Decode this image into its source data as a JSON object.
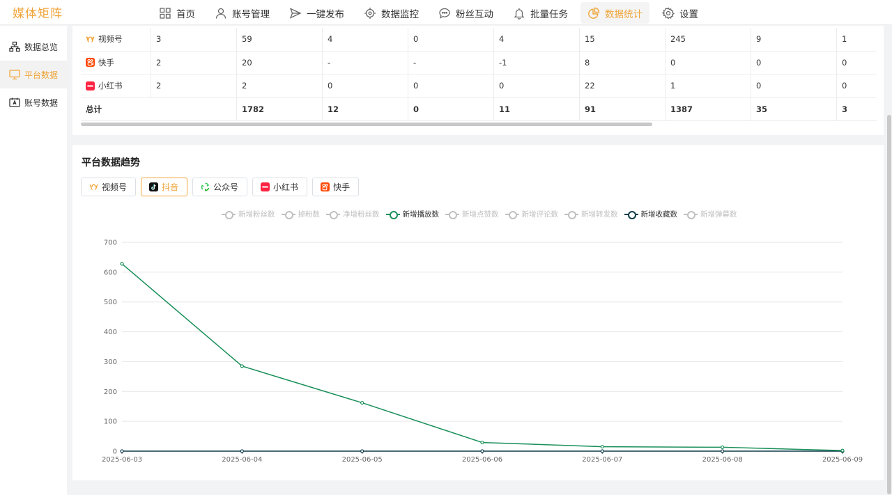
{
  "app": {
    "title": "媒体矩阵"
  },
  "nav": {
    "items": [
      {
        "label": "首页",
        "icon": "grid-icon"
      },
      {
        "label": "账号管理",
        "icon": "user-icon"
      },
      {
        "label": "一键发布",
        "icon": "send-icon"
      },
      {
        "label": "数据监控",
        "icon": "crosshair-icon"
      },
      {
        "label": "粉丝互动",
        "icon": "chat-icon"
      },
      {
        "label": "批量任务",
        "icon": "bell-icon"
      },
      {
        "label": "数据统计",
        "icon": "pie-chart-icon",
        "active": true
      },
      {
        "label": "设置",
        "icon": "gear-icon"
      }
    ]
  },
  "sidebar": {
    "items": [
      {
        "label": "数据总览",
        "icon": "hierarchy-icon"
      },
      {
        "label": "平台数据",
        "icon": "monitor-icon",
        "active": true
      },
      {
        "label": "账号数据",
        "icon": "id-card-icon"
      }
    ]
  },
  "table": {
    "rows": [
      {
        "platform": "视频号",
        "icon": "wechat-channels-icon",
        "cells": [
          "3",
          "59",
          "4",
          "0",
          "4",
          "15",
          "245",
          "9",
          "1"
        ]
      },
      {
        "platform": "快手",
        "icon": "kuaishou-icon",
        "cells": [
          "2",
          "20",
          "-",
          "-",
          "-1",
          "8",
          "0",
          "0",
          "0"
        ]
      },
      {
        "platform": "小红书",
        "icon": "xiaohongshu-icon",
        "cells": [
          "2",
          "2",
          "0",
          "0",
          "0",
          "22",
          "1",
          "0",
          "0"
        ]
      }
    ],
    "total": {
      "label": "总计",
      "cells": [
        "1782",
        "12",
        "0",
        "11",
        "91",
        "1387",
        "35",
        "3"
      ]
    }
  },
  "trend": {
    "title": "平台数据趋势",
    "platform_tabs": [
      {
        "label": "视频号",
        "icon": "wechat-channels-icon"
      },
      {
        "label": "抖音",
        "icon": "douyin-icon",
        "active": true
      },
      {
        "label": "公众号",
        "icon": "wechat-official-icon"
      },
      {
        "label": "小红书",
        "icon": "xiaohongshu-icon"
      },
      {
        "label": "快手",
        "icon": "kuaishou-icon"
      }
    ]
  },
  "colors": {
    "accent": "#f0a53b",
    "plays_line": "#1a8f5a",
    "favorites_line": "#0e3a4a",
    "legend_off": "#c0c0c0"
  },
  "chart_data": {
    "type": "line",
    "x": [
      "2025-06-03",
      "2025-06-04",
      "2025-06-05",
      "2025-06-06",
      "2025-06-07",
      "2025-06-08",
      "2025-06-09"
    ],
    "ylim": [
      0,
      700
    ],
    "yticks": [
      0,
      100,
      200,
      300,
      400,
      500,
      600,
      700
    ],
    "grid": true,
    "legend_position": "top-center",
    "legend": [
      {
        "name": "新增粉丝数",
        "visible": false
      },
      {
        "name": "掉粉数",
        "visible": false
      },
      {
        "name": "净增粉丝数",
        "visible": false
      },
      {
        "name": "新增播放数",
        "visible": true
      },
      {
        "name": "新增点赞数",
        "visible": false
      },
      {
        "name": "新增评论数",
        "visible": false
      },
      {
        "name": "新增转发数",
        "visible": false
      },
      {
        "name": "新增收藏数",
        "visible": true
      },
      {
        "name": "新增弹幕数",
        "visible": false
      }
    ],
    "series": [
      {
        "name": "新增播放数",
        "values": [
          628,
          285,
          162,
          29,
          15,
          13,
          2
        ]
      },
      {
        "name": "新增收藏数",
        "values": [
          0,
          0,
          0,
          0,
          0,
          0,
          0
        ]
      }
    ]
  }
}
